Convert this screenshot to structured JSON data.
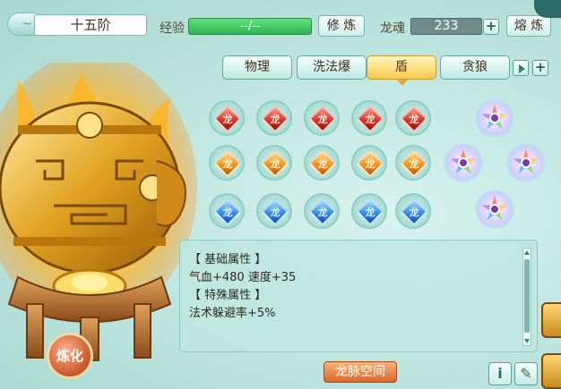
{
  "header": {
    "rank": "十五阶",
    "exp_label": "经验",
    "exp_value": "--/--",
    "cultivate_button": "修 炼",
    "soul_label": "龙魂",
    "soul_value": "233",
    "smelt_button": "熔 炼"
  },
  "tabs": [
    {
      "label": "物理",
      "active": false
    },
    {
      "label": "洗法爆",
      "active": false
    },
    {
      "label": "盾",
      "active": true
    },
    {
      "label": "贪狼",
      "active": false
    }
  ],
  "gems": {
    "rows": [
      {
        "color": "red",
        "count": 5
      },
      {
        "color": "orange",
        "count": 5
      },
      {
        "color": "blue",
        "count": 5
      }
    ],
    "glyph": "龙"
  },
  "attributes": {
    "base_heading": "【 基础属性 】",
    "base_values": "气血+480  速度+35",
    "special_heading": "【 特殊属性 】",
    "special_values": "法术躲避率+5%"
  },
  "buttons": {
    "refine": "炼化",
    "dragon_space": "龙脉空间",
    "info_icon": "i",
    "edit_icon": "✎"
  },
  "colors": {
    "accent_gold": "#f8c94a",
    "exp_green": "#2fb352",
    "panel_teal": "#b9e3dc"
  }
}
